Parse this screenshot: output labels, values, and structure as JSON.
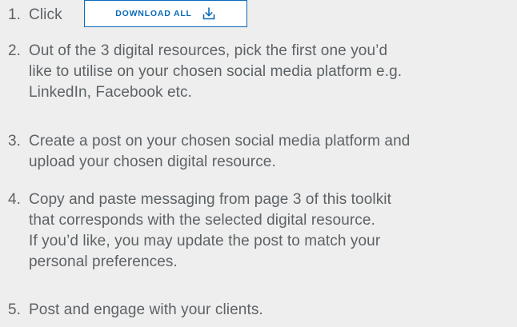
{
  "steps": [
    {
      "number": "1.",
      "text": "Click"
    },
    {
      "number": "2.",
      "lines": [
        "Out of the 3 digital resources, pick the first one you’d",
        "like to utilise on your chosen social media platform e.g.",
        "LinkedIn, Facebook etc."
      ]
    },
    {
      "number": "3.",
      "lines": [
        "Create a post on your chosen social media platform and",
        "upload your chosen digital resource."
      ]
    },
    {
      "number": "4.",
      "lines": [
        "Copy and paste messaging from page 3 of this toolkit",
        "that corresponds with the selected digital resource.",
        "If you’d like, you may update the post to match your",
        "personal preferences."
      ]
    },
    {
      "number": "5.",
      "text": "Post and engage with your clients."
    }
  ],
  "download_button": {
    "label": "DOWNLOAD ALL",
    "icon": "download-icon"
  },
  "colors": {
    "background": "#eeeeee",
    "text": "#5d6266",
    "accent": "#0a6ab8",
    "button_bg": "#ffffff"
  }
}
